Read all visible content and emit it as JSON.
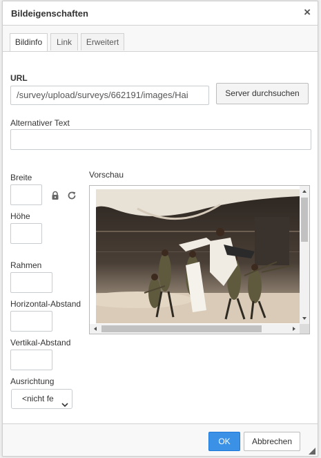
{
  "dialog": {
    "title": "Bildeigenschaften",
    "close_symbol": "×"
  },
  "tabs": [
    {
      "label": "Bildinfo",
      "active": true
    },
    {
      "label": "Link",
      "active": false
    },
    {
      "label": "Erweitert",
      "active": false
    }
  ],
  "form": {
    "url_label": "URL",
    "url_value": "/survey/upload/surveys/662191/images/Hai",
    "browse_label": "Server durchsuchen",
    "alt_label": "Alternativer Text",
    "alt_value": "",
    "width_label": "Breite",
    "width_value": "",
    "height_label": "Höhe",
    "height_value": "",
    "border_label": "Rahmen",
    "border_value": "",
    "hspace_label": "Horizontal-Abstand",
    "hspace_value": "",
    "vspace_label": "Vertikal-Abstand",
    "vspace_value": "",
    "align_label": "Ausrichtung",
    "align_value": "<nicht fe",
    "preview_label": "Vorschau"
  },
  "footer": {
    "ok_label": "OK",
    "cancel_label": "Abbrechen"
  },
  "icons": {
    "lock": "lock-icon",
    "reset": "reset-size-icon",
    "close": "close-icon",
    "chevron": "chevron-down-icon"
  },
  "colors": {
    "primary_button": "#3a91e6",
    "border": "#d1d1d1",
    "footer_bg": "#f8f8f8"
  }
}
